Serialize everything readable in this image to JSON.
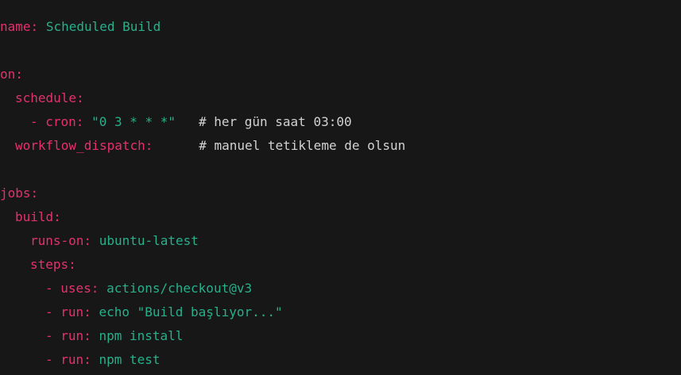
{
  "colors": {
    "background": "#171717",
    "key": "#e6306e",
    "value": "#27b08a",
    "comment": "#d2d2d2"
  },
  "code": {
    "name_key": "name:",
    "name_value": "Scheduled Build",
    "on_key": "on:",
    "schedule_key": "schedule:",
    "cron_dash_key": "- cron:",
    "cron_value": "\"0 3 * * *\"",
    "cron_comment": "# her gün saat 03:00",
    "workflow_dispatch_key": "workflow_dispatch:",
    "workflow_dispatch_comment": "# manuel tetikleme de olsun",
    "jobs_key": "jobs:",
    "build_key": "build:",
    "runs_on_key": "runs-on:",
    "runs_on_value": "ubuntu-latest",
    "steps_key": "steps:",
    "step1_key": "- uses:",
    "step1_value": "actions/checkout@v3",
    "step2_key": "- run:",
    "step2_value": "echo \"Build başlıyor...\"",
    "step3_key": "- run:",
    "step3_value": "npm install",
    "step4_key": "- run:",
    "step4_value": "npm test"
  }
}
